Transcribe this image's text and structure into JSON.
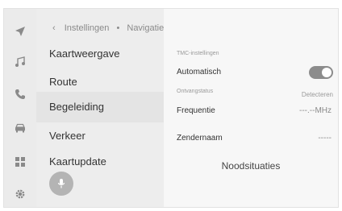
{
  "header": {
    "back_icon": "chevron-left-icon",
    "breadcrumb_parent": "Instellingen",
    "breadcrumb_separator": "•",
    "breadcrumb_current": "Navigatie"
  },
  "rail": {
    "icons": [
      "navigation-icon",
      "music-icon",
      "phone-icon",
      "car-icon",
      "apps-icon",
      "settings-icon"
    ]
  },
  "menu": {
    "items": [
      {
        "label": "Kaartweergave"
      },
      {
        "label": "Route"
      },
      {
        "label": "Begeleiding"
      },
      {
        "label": "Verkeer"
      },
      {
        "label": "Kaartupdate"
      }
    ],
    "selected_index": 2
  },
  "panel": {
    "section_title": "TMC-instellingen",
    "automatic_label": "Automatisch",
    "automatic_on": true,
    "reception_label": "Ontvangstatus",
    "reception_value": "Detecteren",
    "frequency_label": "Frequentie",
    "frequency_value": "---.--MHz",
    "station_label": "Zendernaam",
    "station_value": "-----",
    "emergency_button": "Noodsituaties"
  },
  "colors": {
    "toggle_on": "#8c8c8c",
    "selected_row": "#e4e4e4"
  }
}
